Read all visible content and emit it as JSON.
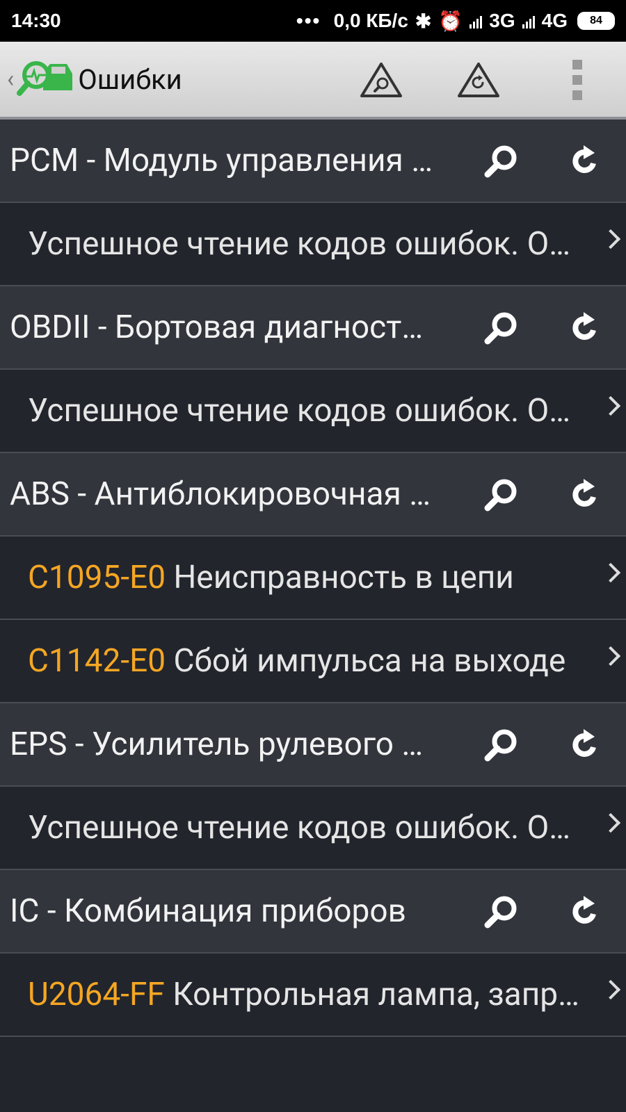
{
  "status_bar": {
    "time": "14:30",
    "dots": "•••",
    "net_speed": "0,0 КБ/с",
    "net1": "3G",
    "net2": "4G",
    "battery": "84"
  },
  "toolbar": {
    "back": "‹",
    "title": "Ошибки"
  },
  "rows": [
    {
      "kind": "module",
      "label": "PCM - Модуль управления двигателем"
    },
    {
      "kind": "item",
      "code": "",
      "text": "Успешное чтение кодов ошибок. Ошибок нет."
    },
    {
      "kind": "module",
      "label": "OBDII - Бортовая диагностика"
    },
    {
      "kind": "item",
      "code": "",
      "text": "Успешное чтение кодов ошибок. Ошибок нет."
    },
    {
      "kind": "module",
      "label": "ABS - Антиблокировочная система"
    },
    {
      "kind": "item",
      "code": "C1095-E0",
      "text": "Неисправность в цепи"
    },
    {
      "kind": "item",
      "code": "C1142-E0",
      "text": "Сбой импульса на выходе"
    },
    {
      "kind": "module",
      "label": "EPS - Усилитель рулевого управления"
    },
    {
      "kind": "item",
      "code": "",
      "text": "Успешное чтение кодов ошибок. Ошибок нет."
    },
    {
      "kind": "module",
      "label": "IC - Комбинация приборов"
    },
    {
      "kind": "item",
      "code": "U2064-FF",
      "text": "Контрольная лампа, запрос"
    }
  ],
  "colors": {
    "code": "#f5a623",
    "logo_green": "#39b54a"
  }
}
